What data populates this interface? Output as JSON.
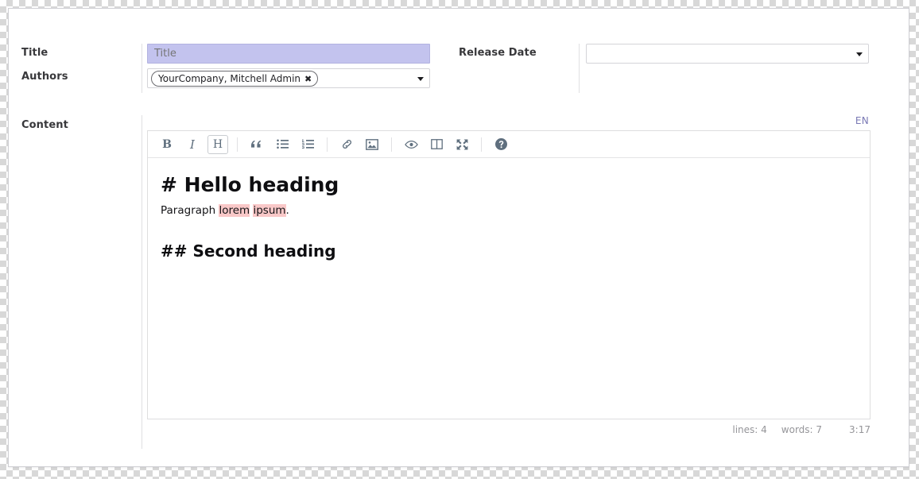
{
  "form": {
    "fields": {
      "title": {
        "label": "Title",
        "value": "",
        "placeholder": "Title"
      },
      "authors": {
        "label": "Authors",
        "tags": [
          {
            "text": "YourCompany, Mitchell Admin",
            "remove_icon": "✖"
          }
        ]
      },
      "release_date": {
        "label": "Release Date",
        "value": "",
        "placeholder": ""
      },
      "content": {
        "label": "Content"
      }
    }
  },
  "editor": {
    "language_badge": "EN",
    "toolbar": [
      {
        "name": "bold",
        "icon": "bold-icon",
        "glyph": "B",
        "active": false
      },
      {
        "name": "italic",
        "icon": "italic-icon",
        "glyph": "I",
        "active": false
      },
      {
        "name": "heading",
        "icon": "heading-icon",
        "glyph": "H",
        "active": true
      },
      {
        "name": "quote",
        "icon": "quote-icon",
        "glyph": "“",
        "active": false
      },
      {
        "name": "unordered-list",
        "icon": "bullet-list-icon",
        "glyph": "",
        "active": false
      },
      {
        "name": "ordered-list",
        "icon": "numbered-list-icon",
        "glyph": "",
        "active": false
      },
      {
        "name": "link",
        "icon": "link-icon",
        "glyph": "",
        "active": false
      },
      {
        "name": "image",
        "icon": "image-icon",
        "glyph": "",
        "active": false
      },
      {
        "name": "preview",
        "icon": "eye-icon",
        "glyph": "",
        "active": false
      },
      {
        "name": "side-by-side",
        "icon": "columns-icon",
        "glyph": "",
        "active": false
      },
      {
        "name": "fullscreen",
        "icon": "expand-arrows-icon",
        "glyph": "",
        "active": false
      },
      {
        "name": "guide",
        "icon": "question-circle-icon",
        "glyph": "",
        "active": false
      }
    ],
    "document": {
      "heading1": "# Hello heading",
      "paragraph": {
        "prefix": "Paragraph ",
        "misspelled_1": "lorem",
        "between": " ",
        "misspelled_2": "ipsum",
        "suffix": "."
      },
      "heading2": "## Second heading"
    },
    "status": {
      "lines_label": "lines: 4",
      "words_label": "words: 7",
      "cursor": "3:17"
    }
  },
  "colors": {
    "title_field_background": "#c3c3ee",
    "spellcheck_highlight": "#f9c8c8",
    "language_badge": "#7a79b5",
    "toolbar_icon": "#5f6f7e",
    "status_text": "#959599"
  }
}
